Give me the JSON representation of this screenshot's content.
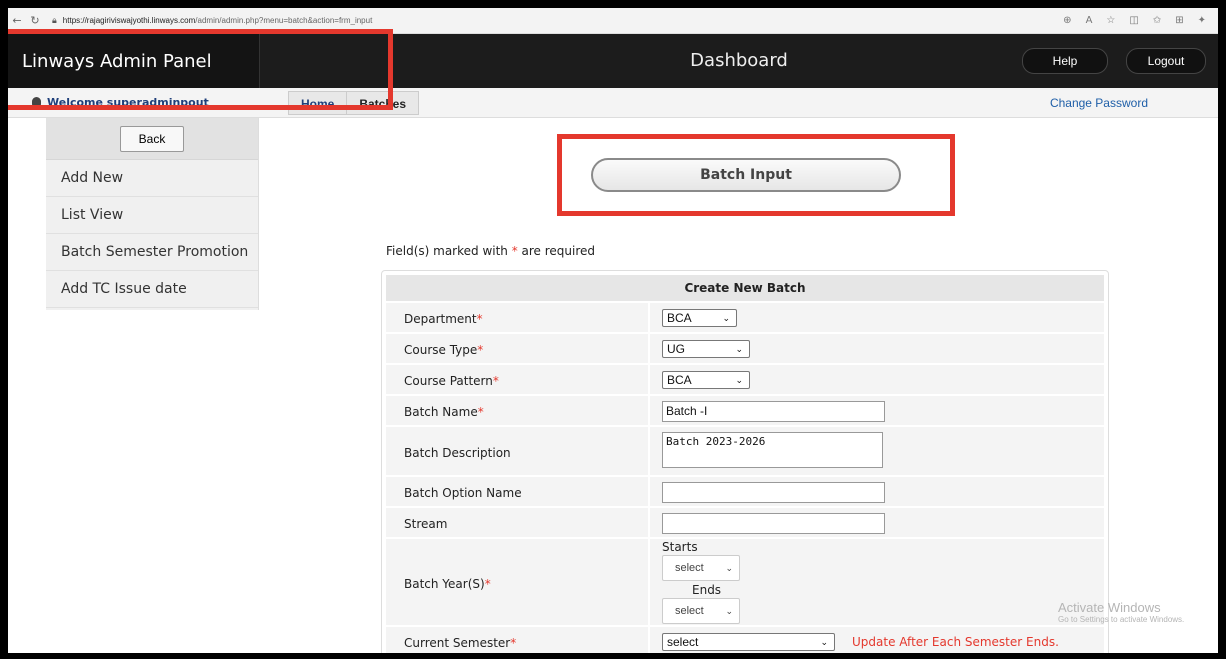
{
  "browser": {
    "url_host": "https://rajagiriviswajyothi.linways.com",
    "url_path": "/admin/admin.php?menu=batch&action=frm_input"
  },
  "header": {
    "brand": "Linways Admin Panel",
    "title": "Dashboard",
    "help": "Help",
    "logout": "Logout"
  },
  "subbar": {
    "welcome": "Welcome superadminpout",
    "breadcrumb": [
      "Home",
      "Batches"
    ],
    "change_password": "Change Password"
  },
  "sidebar": {
    "back": "Back",
    "items": [
      "Add New",
      "List View",
      "Batch Semester Promotion",
      "Add TC Issue date"
    ]
  },
  "page": {
    "heading_button": "Batch Input",
    "required_note_pre": "Field(s) marked with ",
    "required_star": "*",
    "required_note_post": " are required"
  },
  "form": {
    "title": "Create New Batch",
    "department": {
      "label": "Department",
      "value": "BCA"
    },
    "course_type": {
      "label": "Course Type",
      "value": "UG"
    },
    "course_pattern": {
      "label": "Course Pattern",
      "value": "BCA"
    },
    "batch_name": {
      "label": "Batch Name",
      "value": "Batch -I"
    },
    "batch_description": {
      "label": "Batch Description",
      "value": "Batch 2023-2026"
    },
    "batch_option_name": {
      "label": "Batch Option Name",
      "value": ""
    },
    "stream": {
      "label": "Stream",
      "value": ""
    },
    "batch_year": {
      "label": "Batch Year(S)",
      "starts_label": "Starts",
      "ends_label": "Ends",
      "starts_value": "select",
      "ends_value": "select"
    },
    "current_semester": {
      "label": "Current Semester",
      "value": "select",
      "note": "Update After Each Semester Ends."
    }
  },
  "watermark": {
    "line1": "Activate Windows",
    "line2": "Go to Settings to activate Windows."
  },
  "colors": {
    "annotation_red": "#e4382d",
    "header_bg": "#1c1c1c",
    "link_blue": "#1f5fa8"
  }
}
